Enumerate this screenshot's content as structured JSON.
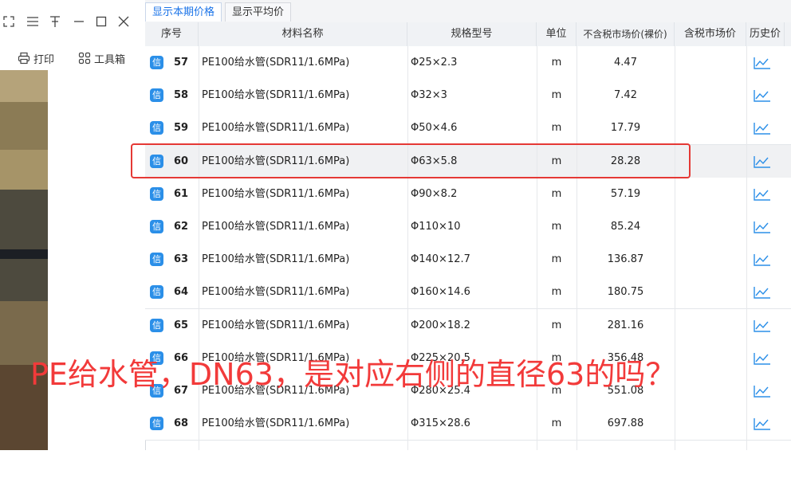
{
  "window": {
    "icons": [
      "expand-icon",
      "menu-icon",
      "pin-icon",
      "minimize-icon",
      "maximize-icon",
      "close-icon"
    ],
    "toolbar": {
      "print_label": "打印",
      "toolbox_label": "工具箱"
    }
  },
  "tabs": [
    {
      "label": "显示本期价格",
      "active": true
    },
    {
      "label": "显示平均价",
      "active": false
    }
  ],
  "table": {
    "headers": [
      "序号",
      "材料名称",
      "规格型号",
      "单位",
      "不含税市场价(裸价)",
      "含税市场价",
      "历史价"
    ],
    "badge": "信",
    "rows": [
      {
        "no": "57",
        "name": "PE100给水管(SDR11/1.6MPa)",
        "spec": "Φ25×2.3",
        "unit": "m",
        "price": "4.47",
        "tax_price": ""
      },
      {
        "no": "58",
        "name": "PE100给水管(SDR11/1.6MPa)",
        "spec": "Φ32×3",
        "unit": "m",
        "price": "7.42",
        "tax_price": ""
      },
      {
        "no": "59",
        "name": "PE100给水管(SDR11/1.6MPa)",
        "spec": "Φ50×4.6",
        "unit": "m",
        "price": "17.79",
        "tax_price": ""
      },
      {
        "no": "60",
        "name": "PE100给水管(SDR11/1.6MPa)",
        "spec": "Φ63×5.8",
        "unit": "m",
        "price": "28.28",
        "tax_price": "",
        "highlighted": true
      },
      {
        "no": "61",
        "name": "PE100给水管(SDR11/1.6MPa)",
        "spec": "Φ90×8.2",
        "unit": "m",
        "price": "57.19",
        "tax_price": ""
      },
      {
        "no": "62",
        "name": "PE100给水管(SDR11/1.6MPa)",
        "spec": "Φ110×10",
        "unit": "m",
        "price": "85.24",
        "tax_price": ""
      },
      {
        "no": "63",
        "name": "PE100给水管(SDR11/1.6MPa)",
        "spec": "Φ140×12.7",
        "unit": "m",
        "price": "136.87",
        "tax_price": ""
      },
      {
        "no": "64",
        "name": "PE100给水管(SDR11/1.6MPa)",
        "spec": "Φ160×14.6",
        "unit": "m",
        "price": "180.75",
        "tax_price": ""
      },
      {
        "no": "65",
        "name": "PE100给水管(SDR11/1.6MPa)",
        "spec": "Φ200×18.2",
        "unit": "m",
        "price": "281.16",
        "tax_price": ""
      },
      {
        "no": "66",
        "name": "PE100给水管(SDR11/1.6MPa)",
        "spec": "Φ225×20.5",
        "unit": "m",
        "price": "356.48",
        "tax_price": ""
      },
      {
        "no": "67",
        "name": "PE100给水管(SDR11/1.6MPa)",
        "spec": "Φ280×25.4",
        "unit": "m",
        "price": "551.08",
        "tax_price": ""
      },
      {
        "no": "68",
        "name": "PE100给水管(SDR11/1.6MPa)",
        "spec": "Φ315×28.6",
        "unit": "m",
        "price": "697.88",
        "tax_price": ""
      }
    ]
  },
  "annotation": {
    "text": "PE给水管，DN63，是对应右侧的直径63的吗？",
    "color": "#f23a3a"
  },
  "colors": {
    "accent": "#2b8fe8",
    "highlight_box": "#e53935"
  }
}
